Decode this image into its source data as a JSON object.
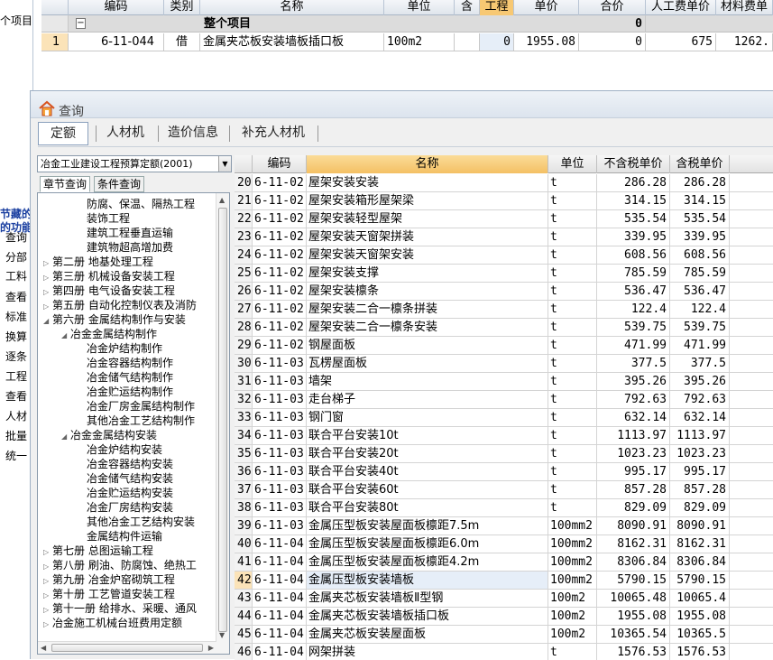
{
  "background": {
    "left_text": "个项目",
    "left_partial_items": [
      "节藏的",
      "的功能",
      "查询",
      "分部",
      "工料",
      "查看",
      "标准",
      "换算",
      "逐条",
      "工程",
      "查看",
      "人材",
      "批量",
      "统一"
    ],
    "top_headers": [
      "编码",
      "类别",
      "名称",
      "单位",
      "含",
      "工程",
      "单价",
      "合价",
      "人工费单价",
      "材料费单"
    ],
    "group_row": {
      "expander": "−",
      "name": "整个项目",
      "total": "0"
    },
    "row": {
      "num": "1",
      "code": "6-11-044",
      "type": "借",
      "name": "金属夹芯板安装墙板插口板",
      "unit": "100m2",
      "qty": "0",
      "price": "1955.08",
      "total": "0",
      "labor": "675",
      "material": "1262."
    }
  },
  "dialog": {
    "title": "查询",
    "tabs": [
      "定额",
      "人材机",
      "造价信息",
      "补充人材机"
    ],
    "library": "冶金工业建设工程预算定额(2001)",
    "subtabs": [
      "章节查询",
      "条件查询"
    ],
    "tree": [
      {
        "label": "防腐、保温、隔热工程",
        "level": 2,
        "ex": ""
      },
      {
        "label": "装饰工程",
        "level": 2,
        "ex": ""
      },
      {
        "label": "建筑工程垂直运输",
        "level": 2,
        "ex": ""
      },
      {
        "label": "建筑物超高增加费",
        "level": 2,
        "ex": ""
      },
      {
        "label": "第二册 地基处理工程",
        "level": 0,
        "ex": "▷"
      },
      {
        "label": "第三册 机械设备安装工程",
        "level": 0,
        "ex": "▷"
      },
      {
        "label": "第四册 电气设备安装工程",
        "level": 0,
        "ex": "▷"
      },
      {
        "label": "第五册 自动化控制仪表及消防",
        "level": 0,
        "ex": "▷"
      },
      {
        "label": "第六册 金属结构制作与安装",
        "level": 0,
        "ex": "◢"
      },
      {
        "label": "冶金金属结构制作",
        "level": 1,
        "ex": "◢"
      },
      {
        "label": "冶金炉结构制作",
        "level": 2,
        "ex": ""
      },
      {
        "label": "冶金容器结构制作",
        "level": 2,
        "ex": ""
      },
      {
        "label": "冶金储气结构制作",
        "level": 2,
        "ex": ""
      },
      {
        "label": "冶金贮运结构制作",
        "level": 2,
        "ex": ""
      },
      {
        "label": "冶金厂房金属结构制作",
        "level": 2,
        "ex": ""
      },
      {
        "label": "其他冶金工艺结构制作",
        "level": 2,
        "ex": ""
      },
      {
        "label": "冶金金属结构安装",
        "level": 1,
        "ex": "◢"
      },
      {
        "label": "冶金炉结构安装",
        "level": 2,
        "ex": ""
      },
      {
        "label": "冶金容器结构安装",
        "level": 2,
        "ex": ""
      },
      {
        "label": "冶金储气结构安装",
        "level": 2,
        "ex": ""
      },
      {
        "label": "冶金贮运结构安装",
        "level": 2,
        "ex": ""
      },
      {
        "label": "冶金厂房结构安装",
        "level": 2,
        "ex": ""
      },
      {
        "label": "其他冶金工艺结构安装",
        "level": 2,
        "ex": ""
      },
      {
        "label": "金属结构件运输",
        "level": 2,
        "ex": ""
      },
      {
        "label": "第七册 总图运输工程",
        "level": 0,
        "ex": "▷"
      },
      {
        "label": "第八册 刷油、防腐蚀、绝热工",
        "level": 0,
        "ex": "▷"
      },
      {
        "label": "第九册 冶金炉窑砌筑工程",
        "level": 0,
        "ex": "▷"
      },
      {
        "label": "第十册 工艺管道安装工程",
        "level": 0,
        "ex": "▷"
      },
      {
        "label": "第十一册 给排水、采暖、通风",
        "level": 0,
        "ex": "▷"
      },
      {
        "label": "冶金施工机械台班费用定额",
        "level": 0,
        "ex": "▷"
      }
    ],
    "grid_headers": [
      "编码",
      "名称",
      "单位",
      "不含税单价",
      "含税单价"
    ],
    "rows": [
      [
        "20",
        "6-11-02",
        "屋架安装安装",
        "t",
        "286.28",
        "286.28"
      ],
      [
        "21",
        "6-11-02",
        "屋架安装箱形屋架梁",
        "t",
        "314.15",
        "314.15"
      ],
      [
        "22",
        "6-11-02",
        "屋架安装轻型屋架",
        "t",
        "535.54",
        "535.54"
      ],
      [
        "23",
        "6-11-02",
        "屋架安装天窗架拼装",
        "t",
        "339.95",
        "339.95"
      ],
      [
        "24",
        "6-11-02",
        "屋架安装天窗架安装",
        "t",
        "608.56",
        "608.56"
      ],
      [
        "25",
        "6-11-02",
        "屋架安装支撑",
        "t",
        "785.59",
        "785.59"
      ],
      [
        "26",
        "6-11-02",
        "屋架安装檩条",
        "t",
        "536.47",
        "536.47"
      ],
      [
        "27",
        "6-11-02",
        "屋架安装二合一檩条拼装",
        "t",
        "122.4",
        "122.4"
      ],
      [
        "28",
        "6-11-02",
        "屋架安装二合一檩条安装",
        "t",
        "539.75",
        "539.75"
      ],
      [
        "29",
        "6-11-02",
        "钢屋面板",
        "t",
        "471.99",
        "471.99"
      ],
      [
        "30",
        "6-11-03",
        "瓦楞屋面板",
        "t",
        "377.5",
        "377.5"
      ],
      [
        "31",
        "6-11-03",
        "墙架",
        "t",
        "395.26",
        "395.26"
      ],
      [
        "32",
        "6-11-03",
        "走台梯子",
        "t",
        "792.63",
        "792.63"
      ],
      [
        "33",
        "6-11-03",
        "钢门窗",
        "t",
        "632.14",
        "632.14"
      ],
      [
        "34",
        "6-11-03",
        "联合平台安装10t",
        "t",
        "1113.97",
        "1113.97"
      ],
      [
        "35",
        "6-11-03",
        "联合平台安装20t",
        "t",
        "1023.23",
        "1023.23"
      ],
      [
        "36",
        "6-11-03",
        "联合平台安装40t",
        "t",
        "995.17",
        "995.17"
      ],
      [
        "37",
        "6-11-03",
        "联合平台安装60t",
        "t",
        "857.28",
        "857.28"
      ],
      [
        "38",
        "6-11-03",
        "联合平台安装80t",
        "t",
        "829.09",
        "829.09"
      ],
      [
        "39",
        "6-11-03",
        "金属压型板安装屋面板檩距7.5m",
        "100mm2",
        "8090.91",
        "8090.91"
      ],
      [
        "40",
        "6-11-04",
        "金属压型板安装屋面板檩距6.0m",
        "100mm2",
        "8162.31",
        "8162.31"
      ],
      [
        "41",
        "6-11-04",
        "金属压型板安装屋面板檩距4.2m",
        "100mm2",
        "8306.84",
        "8306.84"
      ],
      [
        "42",
        "6-11-04",
        "金属压型板安装墙板",
        "100mm2",
        "5790.15",
        "5790.15"
      ],
      [
        "43",
        "6-11-04",
        "金属夹芯板安装墙板Ⅱ型钢",
        "100m2",
        "10065.48",
        "10065.4"
      ],
      [
        "44",
        "6-11-04",
        "金属夹芯板安装墙板插口板",
        "100m2",
        "1955.08",
        "1955.08"
      ],
      [
        "45",
        "6-11-04",
        "金属夹芯板安装屋面板",
        "100m2",
        "10365.54",
        "10365.5"
      ],
      [
        "46",
        "6-11-04",
        "网架拼装",
        "t",
        "1576.53",
        "1576.53"
      ]
    ],
    "selected_row": "42",
    "colors": {
      "selected_num": "#fbe3b8",
      "header_name": "#f7c873"
    }
  }
}
